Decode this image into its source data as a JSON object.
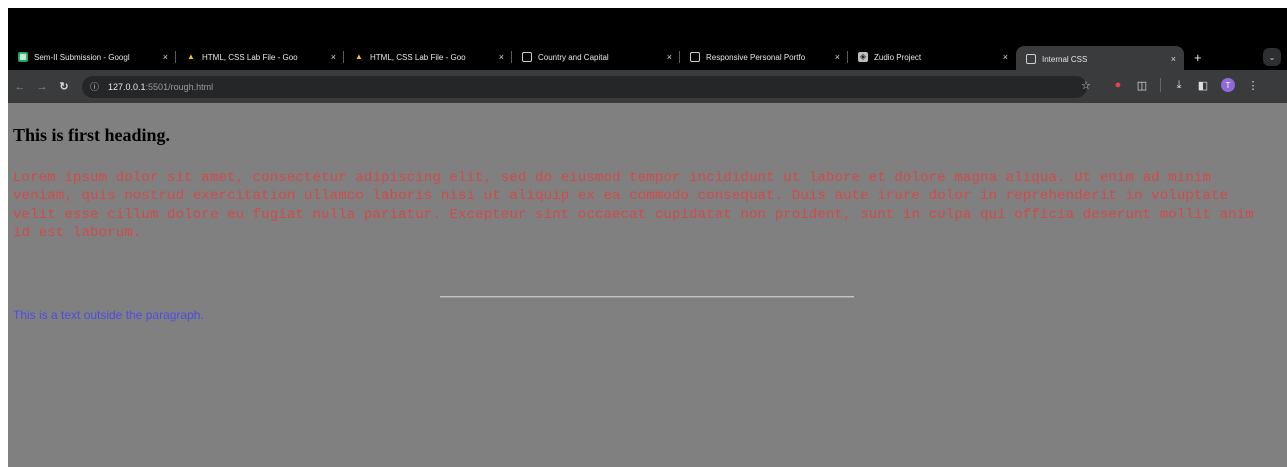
{
  "browser": {
    "tabs": [
      {
        "title": "Sem-II Submission - Googl",
        "favicon": "sheets-icon",
        "active": false
      },
      {
        "title": "HTML, CSS Lab File - Goo",
        "favicon": "drive-icon",
        "active": false
      },
      {
        "title": "HTML, CSS Lab File - Goo",
        "favicon": "drive-icon",
        "active": false
      },
      {
        "title": "Country and Capital",
        "favicon": "globe-icon",
        "active": false
      },
      {
        "title": "Responsive Personal Portfo",
        "favicon": "globe-icon",
        "active": false
      },
      {
        "title": "Zudio Project",
        "favicon": "zudio-icon",
        "active": false
      },
      {
        "title": "Internal CSS",
        "favicon": "globe-icon",
        "active": true
      }
    ],
    "close_glyph": "×",
    "new_tab_glyph": "+",
    "address": {
      "host": "127.0.0.1",
      "rest": ":5501/rough.html"
    },
    "profile_initial": "T"
  },
  "page": {
    "heading": "This is first heading.",
    "paragraph": "Lorem ipsum dolor sit amet, consectetur adipiscing elit, sed do eiusmod tempor incididunt ut labore et dolore magna aliqua. Ut enim ad minim veniam, quis nostrud exercitation ullamco laboris nisi ut aliquip ex ea commodo consequat. Duis aute irure dolor in reprehenderit in voluptate velit esse cillum dolore eu fugiat nulla pariatur. Excepteur sint occaecat cupidatat non proident, sunt in culpa qui officia deserunt mollit anim id est laborum.",
    "outside_text": "This is a text outside the paragraph."
  },
  "colors": {
    "page_background": "#808080",
    "paragraph_text": "#d24a4a",
    "outside_text": "#4c4ce6",
    "toolbar": "#3a3b3d",
    "tabstrip": "#000000"
  }
}
